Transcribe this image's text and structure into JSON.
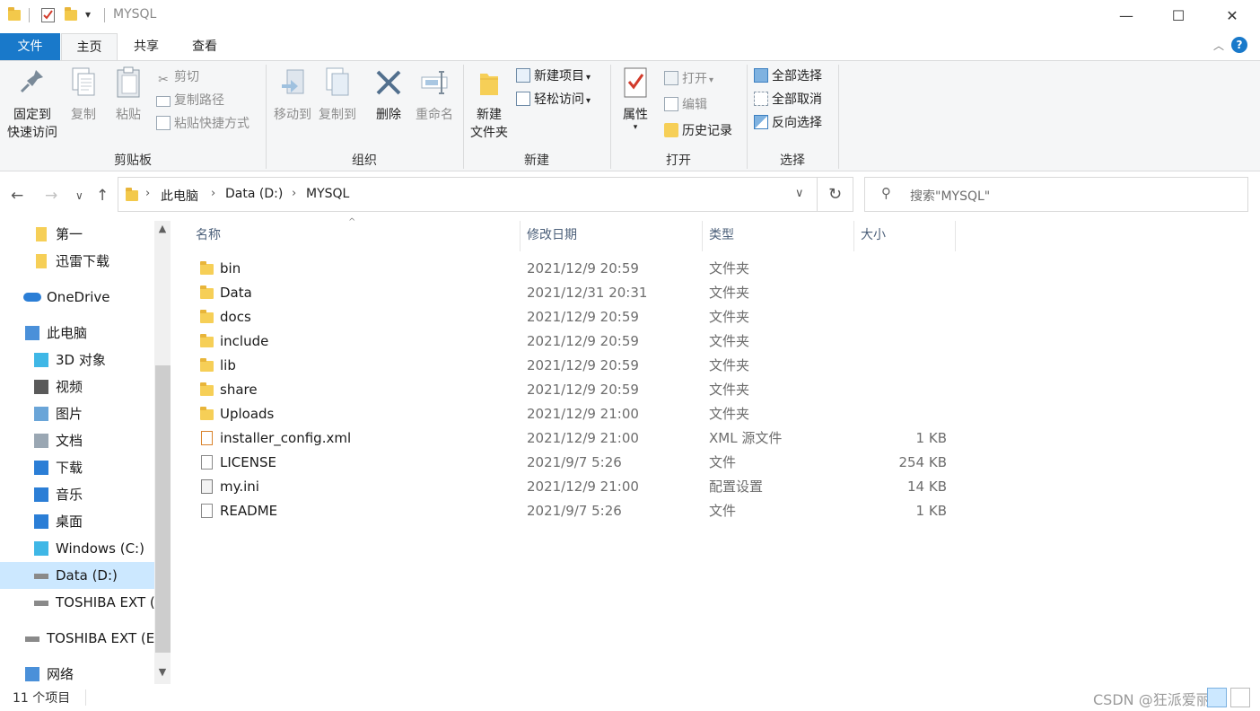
{
  "titlebar": {
    "title": "MYSQL",
    "minimize_glyph": "—",
    "maximize_glyph": "☐",
    "close_glyph": "✕",
    "dropdown_glyph": "▾"
  },
  "tabs": [
    {
      "label": "文件"
    },
    {
      "label": "主页"
    },
    {
      "label": "共享"
    },
    {
      "label": "查看"
    }
  ],
  "help_glyph": "?",
  "ribbon": {
    "clipboard": {
      "label": "剪贴板",
      "pin_line1": "固定到",
      "pin_line2": "快速访问",
      "copy": "复制",
      "paste": "粘贴",
      "cut": "剪切",
      "copy_path": "复制路径",
      "paste_shortcut": "粘贴快捷方式"
    },
    "organize": {
      "label": "组织",
      "move_to": "移动到",
      "copy_to": "复制到",
      "delete": "删除",
      "rename": "重命名"
    },
    "new": {
      "label": "新建",
      "new_folder_line1": "新建",
      "new_folder_line2": "文件夹",
      "new_item": "新建项目",
      "easy_access": "轻松访问"
    },
    "open": {
      "label": "打开",
      "properties": "属性",
      "open": "打开",
      "edit": "编辑",
      "history": "历史记录"
    },
    "select": {
      "label": "选择",
      "select_all": "全部选择",
      "select_none": "全部取消",
      "invert": "反向选择"
    }
  },
  "address": {
    "crumbs": [
      "此电脑",
      "Data (D:)",
      "MYSQL"
    ],
    "search_placeholder": "搜索\"MYSQL\""
  },
  "nav": {
    "items": [
      {
        "label": "第一",
        "icon": "folder-icon",
        "indent": 1
      },
      {
        "label": "迅雷下载",
        "icon": "folder-icon",
        "indent": 1
      },
      {
        "label": "OneDrive",
        "icon": "cloud-icon",
        "indent": 0
      },
      {
        "label": "此电脑",
        "icon": "computer-icon",
        "indent": 0
      },
      {
        "label": "3D 对象",
        "icon": "cube-icon",
        "indent": 1
      },
      {
        "label": "视频",
        "icon": "video-icon",
        "indent": 1
      },
      {
        "label": "图片",
        "icon": "picture-icon",
        "indent": 1
      },
      {
        "label": "文档",
        "icon": "document-icon",
        "indent": 1
      },
      {
        "label": "下载",
        "icon": "download-icon",
        "indent": 1
      },
      {
        "label": "音乐",
        "icon": "music-icon",
        "indent": 1
      },
      {
        "label": "桌面",
        "icon": "desktop-icon",
        "indent": 1
      },
      {
        "label": "Windows (C:)",
        "icon": "windows-drive-icon",
        "indent": 1
      },
      {
        "label": "Data (D:)",
        "icon": "drive-icon",
        "indent": 1,
        "selected": true
      },
      {
        "label": "TOSHIBA EXT (E:)",
        "icon": "drive-icon",
        "indent": 1
      },
      {
        "label": "TOSHIBA EXT (E:)",
        "icon": "drive-icon",
        "indent": 0
      },
      {
        "label": "网络",
        "icon": "network-icon",
        "indent": 0
      }
    ]
  },
  "columns": {
    "name": "名称",
    "date": "修改日期",
    "type": "类型",
    "size": "大小"
  },
  "files": [
    {
      "name": "bin",
      "date": "2021/12/9 20:59",
      "type": "文件夹",
      "size": "",
      "icon": "folder-icon"
    },
    {
      "name": "Data",
      "date": "2021/12/31 20:31",
      "type": "文件夹",
      "size": "",
      "icon": "folder-icon"
    },
    {
      "name": "docs",
      "date": "2021/12/9 20:59",
      "type": "文件夹",
      "size": "",
      "icon": "folder-icon"
    },
    {
      "name": "include",
      "date": "2021/12/9 20:59",
      "type": "文件夹",
      "size": "",
      "icon": "folder-icon"
    },
    {
      "name": "lib",
      "date": "2021/12/9 20:59",
      "type": "文件夹",
      "size": "",
      "icon": "folder-icon"
    },
    {
      "name": "share",
      "date": "2021/12/9 20:59",
      "type": "文件夹",
      "size": "",
      "icon": "folder-icon"
    },
    {
      "name": "Uploads",
      "date": "2021/12/9 21:00",
      "type": "文件夹",
      "size": "",
      "icon": "folder-icon"
    },
    {
      "name": "installer_config.xml",
      "date": "2021/12/9 21:00",
      "type": "XML 源文件",
      "size": "1 KB",
      "icon": "xml-file-icon"
    },
    {
      "name": "LICENSE",
      "date": "2021/9/7 5:26",
      "type": "文件",
      "size": "254 KB",
      "icon": "file-icon"
    },
    {
      "name": "my.ini",
      "date": "2021/12/9 21:00",
      "type": "配置设置",
      "size": "14 KB",
      "icon": "ini-file-icon"
    },
    {
      "name": "README",
      "date": "2021/9/7 5:26",
      "type": "文件",
      "size": "1 KB",
      "icon": "file-icon"
    }
  ],
  "status": {
    "count": "11 个项目",
    "watermark": "CSDN @狂派爱丽丝"
  },
  "colors": {
    "accent": "#1979ca",
    "folder": "#f6cf57",
    "selection": "#cce8ff"
  }
}
